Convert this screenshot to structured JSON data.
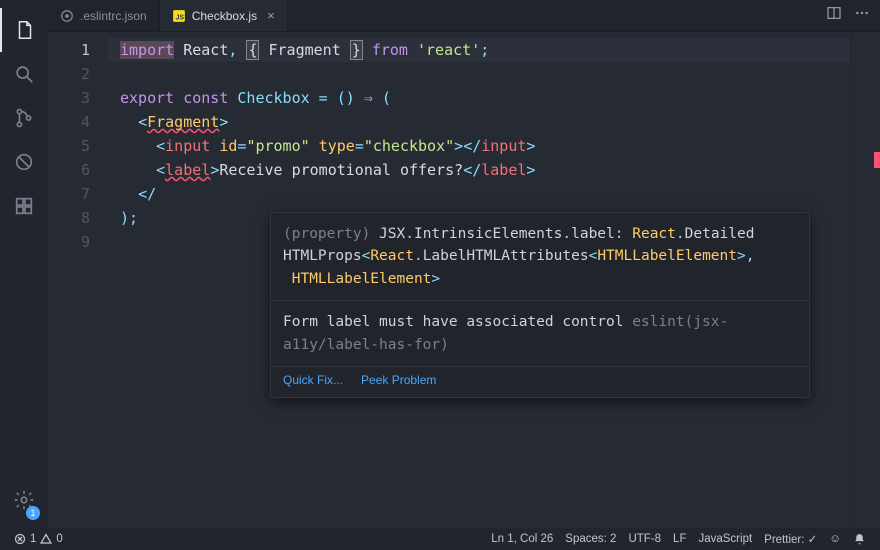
{
  "tabs": [
    {
      "label": ".eslintrc.json",
      "icon": "settings-json"
    },
    {
      "label": "Checkbox.js",
      "icon": "js"
    }
  ],
  "activeTabClose": "×",
  "lineNumbers": [
    "1",
    "2",
    "3",
    "4",
    "5",
    "6",
    "7",
    "8",
    "9"
  ],
  "currentLineIndex": 0,
  "code": {
    "l1": {
      "import": "import",
      "react": "React",
      "comma": ", ",
      "lb": "{",
      "frag": "Fragment",
      "rb": "}",
      "from": " from ",
      "q": "'",
      "pkg": "react",
      "semi": ";"
    },
    "l3": {
      "export": "export",
      "const": "const",
      "name": "Checkbox",
      "eq": " = ",
      "paren": "()",
      "arrow": " ⇒ ",
      "open": "("
    },
    "l4": {
      "lt": "<",
      "tag": "Fragment",
      "gt": ">"
    },
    "l5": {
      "lt": "<",
      "tag": "input",
      "sp": " ",
      "attr1": "id",
      "eq1": "=",
      "q": "\"",
      "v1": "promo",
      "attr2": "type",
      "eq2": "=",
      "v2": "checkbox",
      "gt": ">",
      "lts": "</",
      "gte": ">"
    },
    "l6": {
      "lt": "<",
      "tag": "label",
      "gt": ">",
      "text": "Receive promotional offers?",
      "lts": "</"
    },
    "l7": {
      "lt": "</"
    },
    "l8": {
      "close": ");"
    }
  },
  "hover": {
    "sig_plain": "(property) JSX.IntrinsicElements.label: React.Detailed\nHTMLProps<React.LabelHTMLAttributes<HTMLLabelElement>,\n HTMLLabelElement>",
    "msg": "Form label must have associated control",
    "source": "eslint(jsx-a11y/label-has-for)",
    "quickfix": "Quick Fix...",
    "peek": "Peek Problem"
  },
  "status": {
    "errors": "1",
    "warnings": "0",
    "lncol": "Ln 1, Col 26",
    "spaces": "Spaces: 2",
    "encoding": "UTF-8",
    "eol": "LF",
    "lang": "JavaScript",
    "prettier": "Prettier: ✓",
    "feedback": "☺"
  },
  "gearBadge": "1"
}
